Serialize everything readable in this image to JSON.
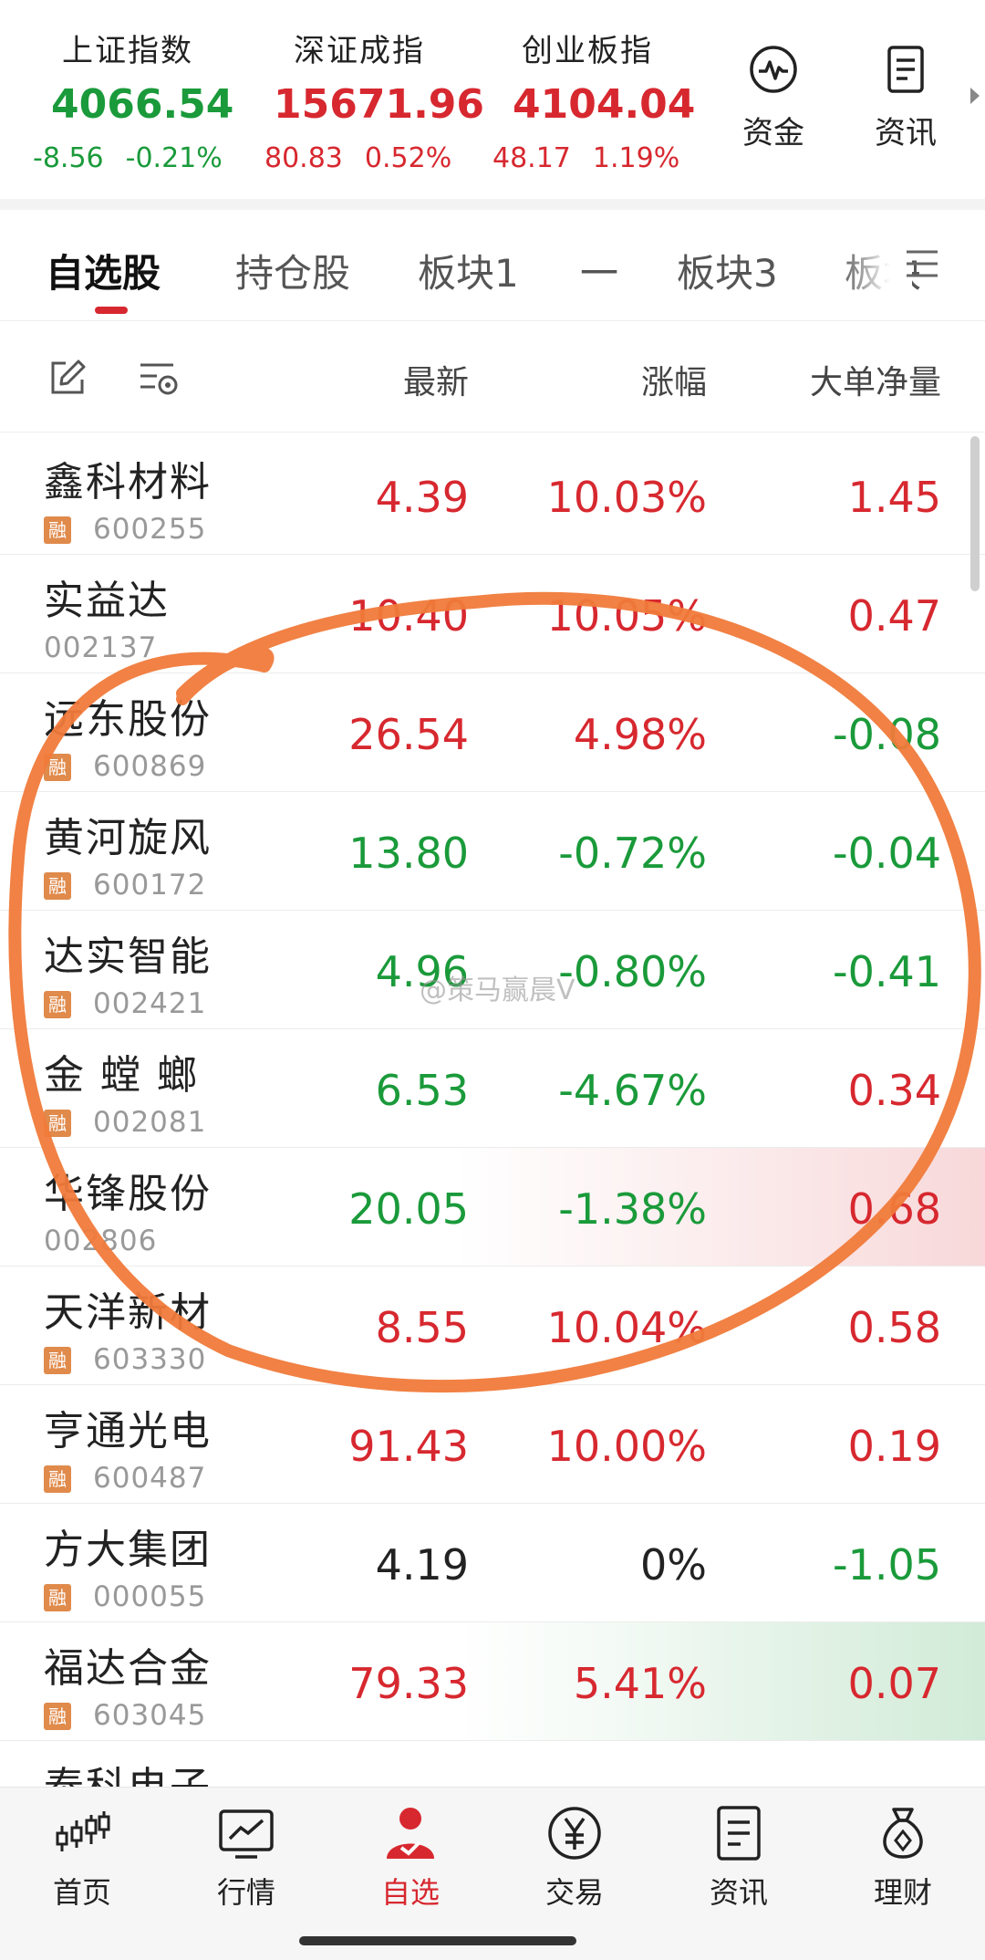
{
  "indices": [
    {
      "name": "上证指数",
      "value": "4066.54",
      "change": "-8.56",
      "pct": "-0.21%",
      "dir": "down"
    },
    {
      "name": "深证成指",
      "value": "15671.96",
      "change": "80.83",
      "pct": "0.52%",
      "dir": "up"
    },
    {
      "name": "创业板指",
      "value": "4104.04",
      "change": "48.17",
      "pct": "1.19%",
      "dir": "up"
    }
  ],
  "quick_actions": [
    {
      "label": "资金",
      "icon": "pulse-icon"
    },
    {
      "label": "资讯",
      "icon": "document-icon"
    }
  ],
  "tabs": [
    "自选股",
    "持仓股",
    "板块1",
    "一",
    "板块3",
    "板块"
  ],
  "columns": {
    "latest": "最新",
    "change": "涨幅",
    "net": "大单净量"
  },
  "badge_label": "融",
  "stocks": [
    {
      "name": "鑫科材料",
      "code": "600255",
      "margin": true,
      "price": "4.39",
      "pct": "10.03%",
      "net": "1.45",
      "price_dir": "up",
      "pct_dir": "up",
      "net_dir": "up"
    },
    {
      "name": "实益达",
      "code": "002137",
      "margin": false,
      "price": "10.40",
      "pct": "10.05%",
      "net": "0.47",
      "price_dir": "up",
      "pct_dir": "up",
      "net_dir": "up"
    },
    {
      "name": "远东股份",
      "code": "600869",
      "margin": true,
      "price": "26.54",
      "pct": "4.98%",
      "net": "-0.08",
      "price_dir": "up",
      "pct_dir": "up",
      "net_dir": "down"
    },
    {
      "name": "黄河旋风",
      "code": "600172",
      "margin": true,
      "price": "13.80",
      "pct": "-0.72%",
      "net": "-0.04",
      "price_dir": "down",
      "pct_dir": "down",
      "net_dir": "down"
    },
    {
      "name": "达实智能",
      "code": "002421",
      "margin": true,
      "price": "4.96",
      "pct": "-0.80%",
      "net": "-0.41",
      "price_dir": "down",
      "pct_dir": "down",
      "net_dir": "down"
    },
    {
      "name": "金 螳 螂",
      "code": "002081",
      "margin": true,
      "price": "6.53",
      "pct": "-4.67%",
      "net": "0.34",
      "price_dir": "down",
      "pct_dir": "down",
      "net_dir": "up"
    },
    {
      "name": "华锋股份",
      "code": "002806",
      "margin": false,
      "price": "20.05",
      "pct": "-1.38%",
      "net": "0.68",
      "price_dir": "down",
      "pct_dir": "down",
      "net_dir": "up"
    },
    {
      "name": "天洋新材",
      "code": "603330",
      "margin": true,
      "price": "8.55",
      "pct": "10.04%",
      "net": "0.58",
      "price_dir": "up",
      "pct_dir": "up",
      "net_dir": "up"
    },
    {
      "name": "亨通光电",
      "code": "600487",
      "margin": true,
      "price": "91.43",
      "pct": "10.00%",
      "net": "0.19",
      "price_dir": "up",
      "pct_dir": "up",
      "net_dir": "up"
    },
    {
      "name": "方大集团",
      "code": "000055",
      "margin": true,
      "price": "4.19",
      "pct": "0%",
      "net": "-1.05",
      "price_dir": "flat",
      "pct_dir": "flat",
      "net_dir": "down"
    },
    {
      "name": "福达合金",
      "code": "603045",
      "margin": true,
      "price": "79.33",
      "pct": "5.41%",
      "net": "0.07",
      "price_dir": "up",
      "pct_dir": "up",
      "net_dir": "up"
    },
    {
      "name": "泰科电子",
      "code": "",
      "margin": false,
      "price": "",
      "pct": "",
      "net": "",
      "price_dir": "up",
      "pct_dir": "up",
      "net_dir": "up"
    }
  ],
  "watermark": "@策马赢晨V",
  "bottom_nav": [
    {
      "label": "首页",
      "icon": "candlestick-icon"
    },
    {
      "label": "行情",
      "icon": "chart-monitor-icon"
    },
    {
      "label": "自选",
      "icon": "user-check-icon"
    },
    {
      "label": "交易",
      "icon": "yen-icon"
    },
    {
      "label": "资讯",
      "icon": "news-icon"
    },
    {
      "label": "理财",
      "icon": "money-bag-icon"
    }
  ],
  "colors": {
    "up": "#d7282f",
    "down": "#1a9a3a",
    "annotation": "#f07a3a",
    "badge": "#e08a4b"
  }
}
